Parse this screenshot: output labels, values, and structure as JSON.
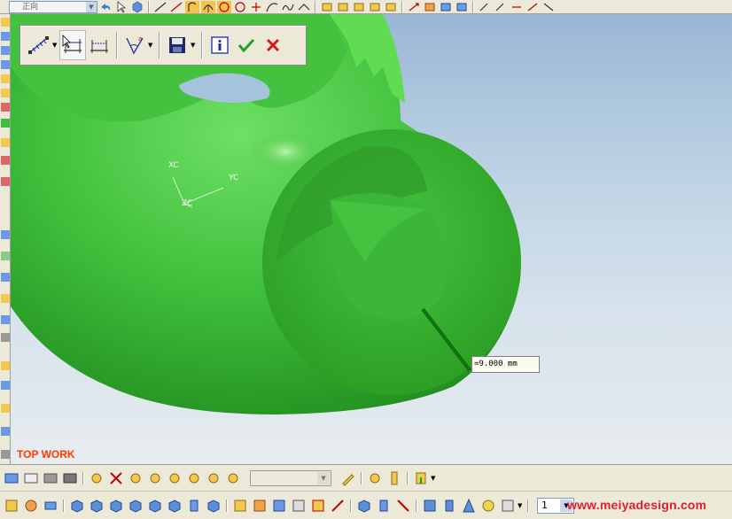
{
  "top_toolbar": {
    "view_select_value": "正向"
  },
  "viewport": {
    "work_label": "TOP WORK",
    "dimension_readout": "=9.000 mm",
    "axes": {
      "x": "XC",
      "y": "YC",
      "z": "ZC"
    }
  },
  "measure_toolbar": {
    "icons": [
      "distance-icon",
      "projected-distance-icon",
      "screen-distance-icon",
      "angle-icon",
      "save-icon",
      "info-icon",
      "ok-check-icon",
      "cancel-x-icon"
    ],
    "colors": {
      "ok": "#17a32a",
      "cancel": "#d61a1a",
      "info": "#1a2db0"
    }
  },
  "bottom_toolbar": {
    "layer_value": "",
    "number_value": "1"
  },
  "watermark": "www.meiyadesign.com",
  "colors": {
    "model_green": "#3fbe3b",
    "model_dark": "#1f8a1d",
    "work_label": "#ff3a00",
    "watermark": "#e0202a"
  }
}
